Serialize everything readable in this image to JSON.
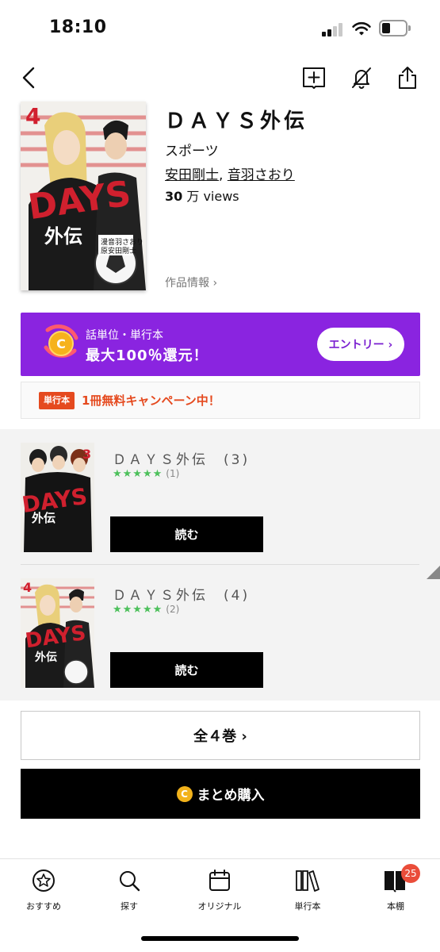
{
  "status": {
    "time": "18:10"
  },
  "header": {
    "back_icon": "chevron-left-icon",
    "bookmark_icon": "add-bookmark-icon",
    "notify_icon": "bell-off-icon",
    "share_icon": "share-icon"
  },
  "series": {
    "title": "ＤＡＹＳ外伝",
    "genre": "スポーツ",
    "author1": "安田剛士",
    "author_sep": ", ",
    "author2": "音羽さおり",
    "views_num": "30",
    "views_unit": " 万 views",
    "info_link": "作品情報 ›"
  },
  "banner": {
    "sub": "話単位・単行本",
    "main": "最大100％還元！",
    "button": "エントリー ›",
    "color": "#8a24e0"
  },
  "promo": {
    "tag": "単行本",
    "text": "1冊無料キャンペーン中！",
    "color": "#e54a1f"
  },
  "volumes": [
    {
      "title": "ＤＡＹＳ外伝　(3)",
      "stars": "★★★★★",
      "count": "(1)",
      "button": "読む"
    },
    {
      "title": "ＤＡＹＳ外伝　(4)",
      "stars": "★★★★★",
      "count": "(2)",
      "button": "読む"
    }
  ],
  "actions": {
    "all_volumes": "全４巻 ›",
    "bulk_buy": "まとめ購入",
    "coin_glyph": "C"
  },
  "tabs": [
    {
      "label": "おすすめ",
      "icon": "star-badge-icon"
    },
    {
      "label": "探す",
      "icon": "search-icon"
    },
    {
      "label": "オリジナル",
      "icon": "calendar-icon"
    },
    {
      "label": "単行本",
      "icon": "books-icon"
    },
    {
      "label": "本棚",
      "icon": "bookshelf-icon",
      "badge": "25"
    }
  ]
}
